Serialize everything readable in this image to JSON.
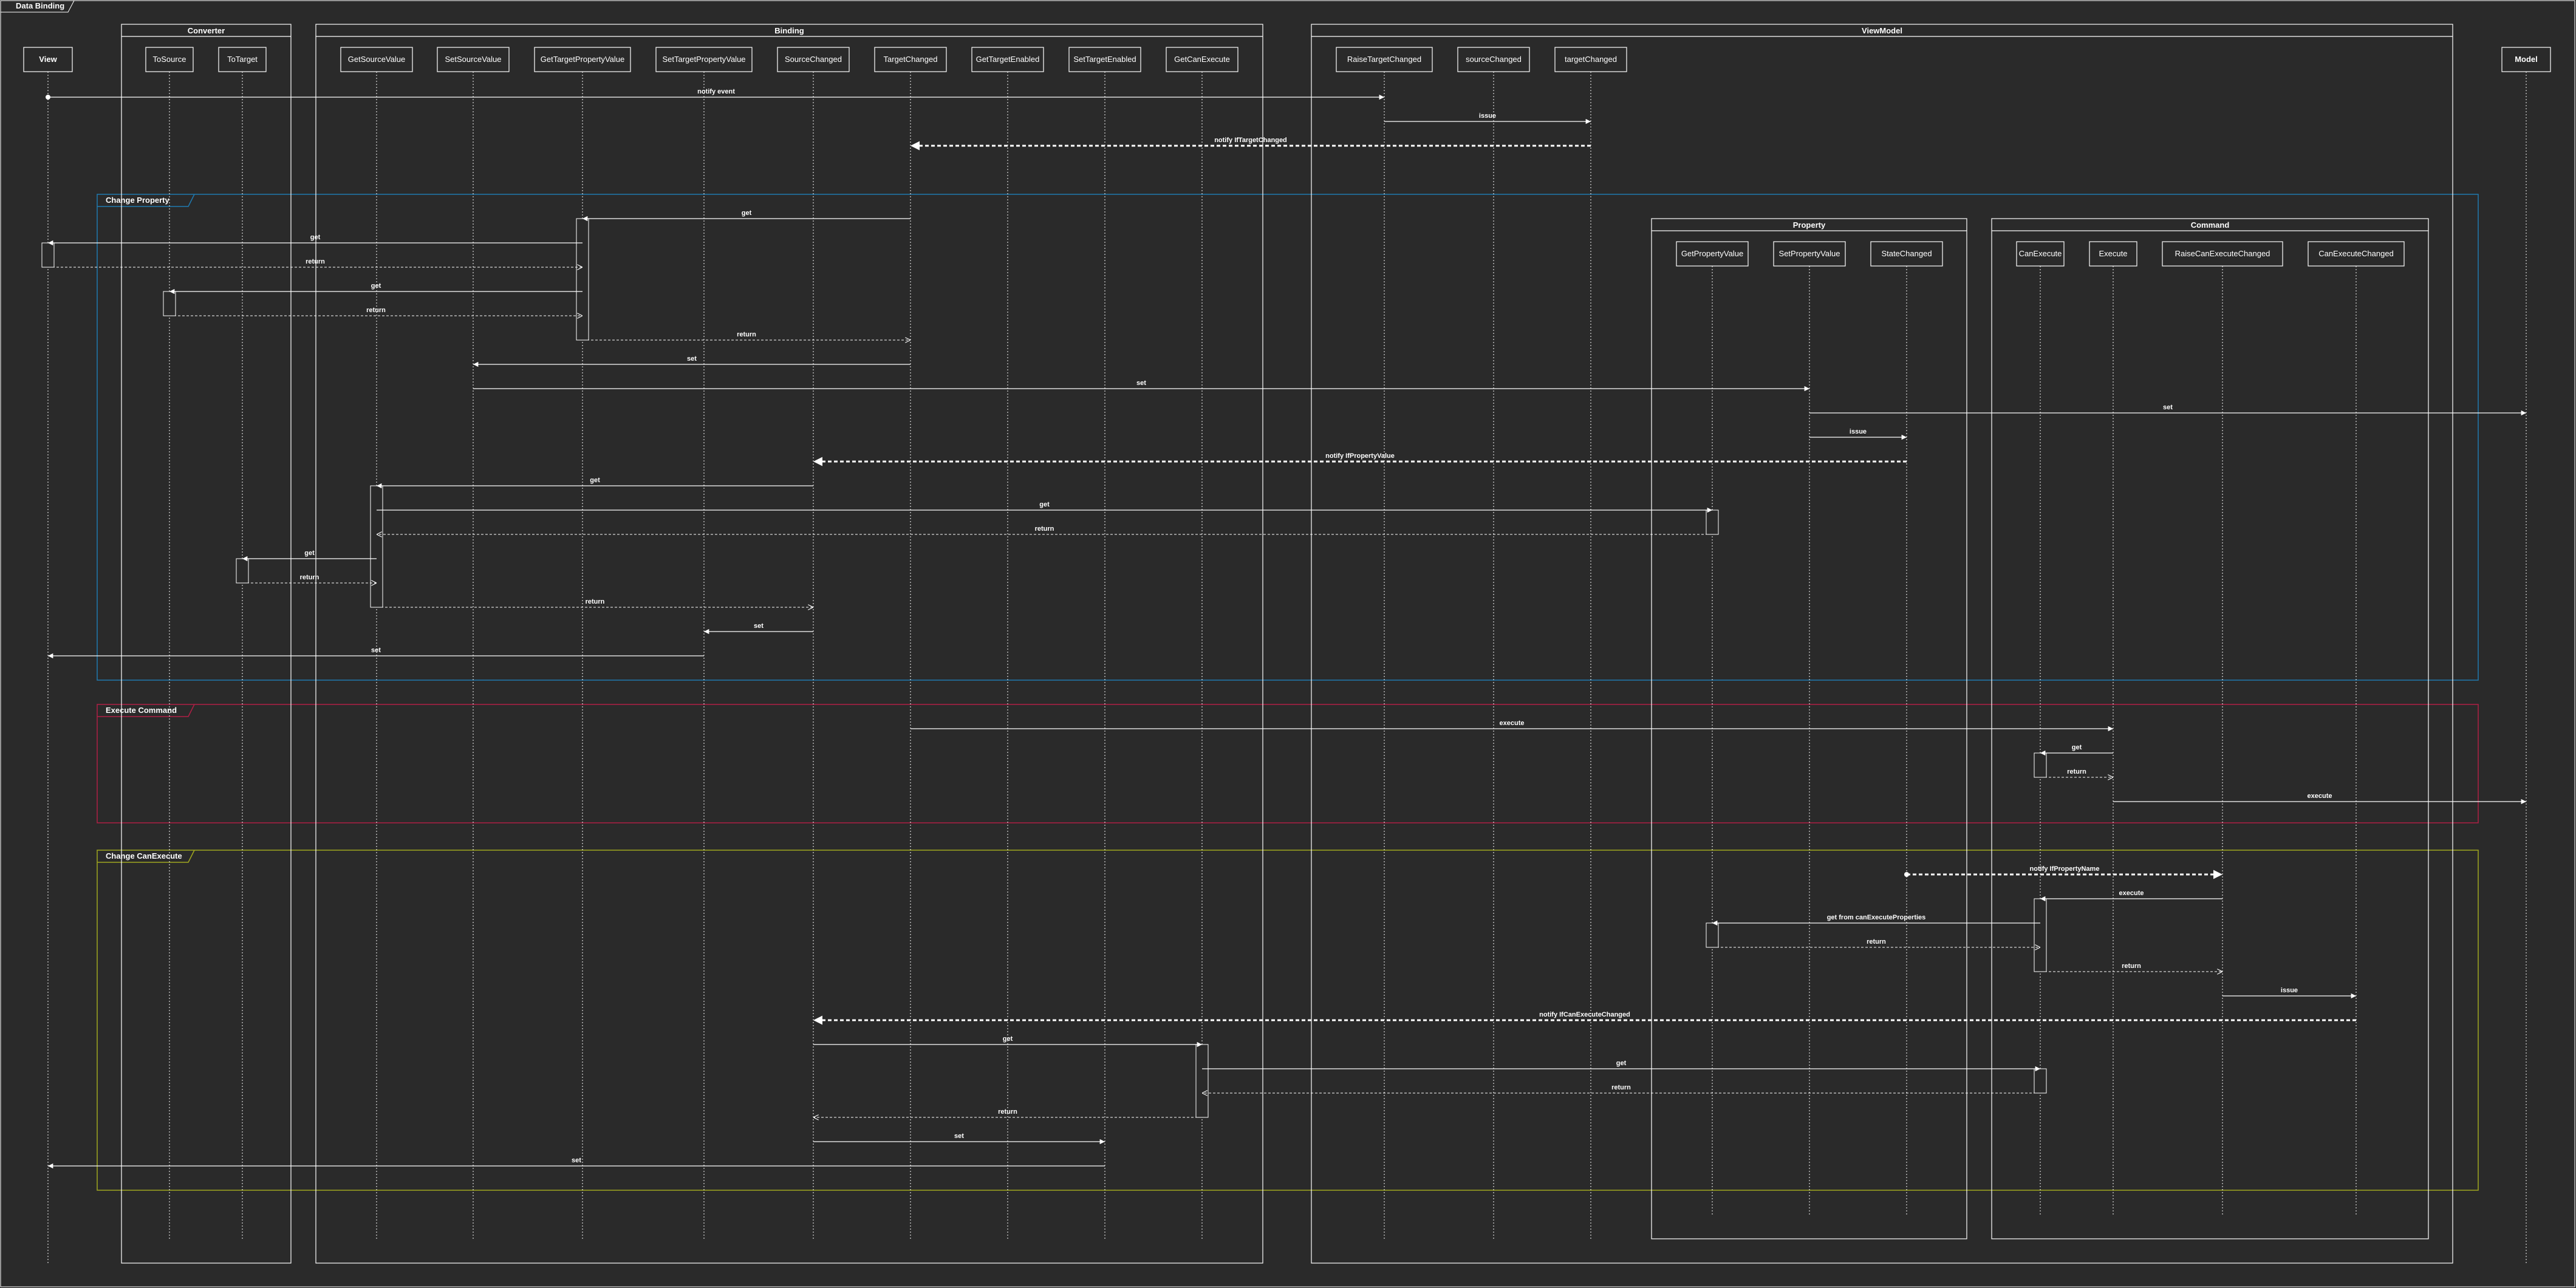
{
  "diagram_title": "Data Binding",
  "groups": [
    {
      "id": "converter",
      "label": "Converter"
    },
    {
      "id": "binding",
      "label": "Binding"
    },
    {
      "id": "viewmodel",
      "label": "ViewModel"
    },
    {
      "id": "property",
      "label": "Property"
    },
    {
      "id": "command",
      "label": "Command"
    }
  ],
  "participants": [
    {
      "id": "view",
      "label": "View"
    },
    {
      "id": "tosource",
      "label": "ToSource"
    },
    {
      "id": "totarget",
      "label": "ToTarget"
    },
    {
      "id": "getsourcevalue",
      "label": "GetSourceValue"
    },
    {
      "id": "setsourcevalue",
      "label": "SetSourceValue"
    },
    {
      "id": "gettargetpropertyvalue",
      "label": "GetTargetPropertyValue"
    },
    {
      "id": "settargetpropertyvalue",
      "label": "SetTargetPropertyValue"
    },
    {
      "id": "sourcechanged",
      "label": "SourceChanged"
    },
    {
      "id": "targetchanged",
      "label": "TargetChanged"
    },
    {
      "id": "gettargetenabled",
      "label": "GetTargetEnabled"
    },
    {
      "id": "settargetenabled",
      "label": "SetTargetEnabled"
    },
    {
      "id": "getcanexecute",
      "label": "GetCanExecute"
    },
    {
      "id": "raisetargetchanged",
      "label": "RaiseTargetChanged"
    },
    {
      "id": "sourcechanged_vm",
      "label": "sourceChanged"
    },
    {
      "id": "targetchanged_vm",
      "label": "targetChanged"
    },
    {
      "id": "getpropertyvalue",
      "label": "GetPropertyValue"
    },
    {
      "id": "setpropertyvalue",
      "label": "SetPropertyValue"
    },
    {
      "id": "statechanged",
      "label": "StateChanged"
    },
    {
      "id": "canexecute",
      "label": "CanExecute"
    },
    {
      "id": "execute",
      "label": "Execute"
    },
    {
      "id": "raisecanexecutechanged",
      "label": "RaiseCanExecuteChanged"
    },
    {
      "id": "canexecutechanged",
      "label": "CanExecuteChanged"
    },
    {
      "id": "model",
      "label": "Model"
    }
  ],
  "fragments": [
    {
      "id": "change-property",
      "label": "Change Property",
      "color": "#1f6f9e"
    },
    {
      "id": "execute-command",
      "label": "Execute Command",
      "color": "#9e1f3a"
    },
    {
      "id": "change-canexecute",
      "label": "Change CanExecute",
      "color": "#9ea01f"
    }
  ],
  "messages": [
    {
      "from": "view",
      "to": "raisetargetchanged",
      "label": "notify event",
      "kind": "found"
    },
    {
      "from": "raisetargetchanged",
      "to": "targetchanged_vm",
      "label": "issue",
      "kind": "sync"
    },
    {
      "from": "targetchanged_vm",
      "to": "targetchanged",
      "label": "notify IfTargetChanged",
      "kind": "async"
    },
    {
      "from": "targetchanged",
      "to": "gettargetpropertyvalue",
      "label": "get",
      "kind": "sync"
    },
    {
      "from": "gettargetpropertyvalue",
      "to": "view",
      "label": "get",
      "kind": "sync"
    },
    {
      "from": "view",
      "to": "gettargetpropertyvalue",
      "label": "return",
      "kind": "reply"
    },
    {
      "from": "gettargetpropertyvalue",
      "to": "tosource",
      "label": "get",
      "kind": "sync"
    },
    {
      "from": "tosource",
      "to": "gettargetpropertyvalue",
      "label": "return",
      "kind": "reply"
    },
    {
      "from": "gettargetpropertyvalue",
      "to": "targetchanged",
      "label": "return",
      "kind": "reply"
    },
    {
      "from": "targetchanged",
      "to": "setsourcevalue",
      "label": "set",
      "kind": "sync"
    },
    {
      "from": "setsourcevalue",
      "to": "setpropertyvalue",
      "label": "set",
      "kind": "sync"
    },
    {
      "from": "setpropertyvalue",
      "to": "model",
      "label": "set",
      "kind": "sync"
    },
    {
      "from": "setpropertyvalue",
      "to": "statechanged",
      "label": "issue",
      "kind": "sync"
    },
    {
      "from": "statechanged",
      "to": "sourcechanged",
      "label": "notify IfPropertyValue",
      "kind": "async"
    },
    {
      "from": "sourcechanged",
      "to": "getsourcevalue",
      "label": "get",
      "kind": "sync"
    },
    {
      "from": "getsourcevalue",
      "to": "getpropertyvalue",
      "label": "get",
      "kind": "sync"
    },
    {
      "from": "getpropertyvalue",
      "to": "getsourcevalue",
      "label": "return",
      "kind": "reply"
    },
    {
      "from": "getsourcevalue",
      "to": "totarget",
      "label": "get",
      "kind": "sync"
    },
    {
      "from": "totarget",
      "to": "getsourcevalue",
      "label": "return",
      "kind": "reply"
    },
    {
      "from": "getsourcevalue",
      "to": "sourcechanged",
      "label": "return",
      "kind": "reply"
    },
    {
      "from": "sourcechanged",
      "to": "settargetpropertyvalue",
      "label": "set",
      "kind": "sync"
    },
    {
      "from": "settargetpropertyvalue",
      "to": "view",
      "label": "set",
      "kind": "sync"
    },
    {
      "from": "targetchanged",
      "to": "execute",
      "label": "execute",
      "kind": "sync"
    },
    {
      "from": "execute",
      "to": "canexecute",
      "label": "get",
      "kind": "sync"
    },
    {
      "from": "canexecute",
      "to": "execute",
      "label": "return",
      "kind": "reply"
    },
    {
      "from": "execute",
      "to": "model",
      "label": "execute",
      "kind": "sync"
    },
    {
      "from": "statechanged",
      "to": "raisecanexecutechanged",
      "label": "notify IfPropertyName",
      "kind": "foundasync"
    },
    {
      "from": "raisecanexecutechanged",
      "to": "canexecute",
      "label": "execute",
      "kind": "sync"
    },
    {
      "from": "canexecute",
      "to": "getpropertyvalue",
      "label": "get from canExecuteProperties",
      "kind": "sync"
    },
    {
      "from": "getpropertyvalue",
      "to": "canexecute",
      "label": "return",
      "kind": "reply"
    },
    {
      "from": "canexecute",
      "to": "raisecanexecutechanged",
      "label": "return",
      "kind": "reply"
    },
    {
      "from": "raisecanexecutechanged",
      "to": "canexecutechanged",
      "label": "issue",
      "kind": "sync"
    },
    {
      "from": "canexecutechanged",
      "to": "sourcechanged",
      "label": "notify IfCanExecuteChanged",
      "kind": "async"
    },
    {
      "from": "sourcechanged",
      "to": "getcanexecute",
      "label": "get",
      "kind": "sync"
    },
    {
      "from": "getcanexecute",
      "to": "canexecute",
      "label": "get",
      "kind": "sync"
    },
    {
      "from": "canexecute",
      "to": "getcanexecute",
      "label": "return",
      "kind": "reply"
    },
    {
      "from": "getcanexecute",
      "to": "sourcechanged",
      "label": "return",
      "kind": "reply"
    },
    {
      "from": "sourcechanged",
      "to": "settargetenabled",
      "label": "set",
      "kind": "sync"
    },
    {
      "from": "settargetenabled",
      "to": "view",
      "label": "set",
      "kind": "sync"
    }
  ],
  "colors": {
    "background": "#2a2a2a",
    "line": "#ffffff"
  }
}
